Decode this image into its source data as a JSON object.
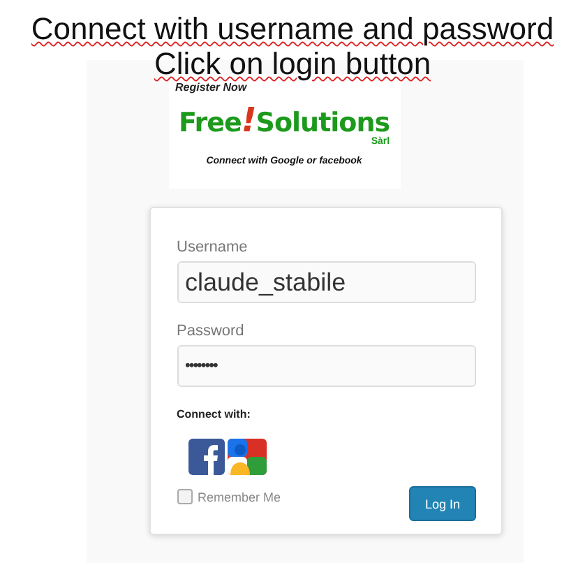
{
  "instructions": [
    "Connect with username and password",
    "Click on login button"
  ],
  "register_link": "Register Now",
  "logo": {
    "word_1": "Free",
    "mark": "!",
    "word_2": "Solutions",
    "suffix": "Sàrl",
    "tagline": "Connect with Google or facebook"
  },
  "form": {
    "username": {
      "label": "Username",
      "value": "claude_stabile"
    },
    "password": {
      "label": "Password",
      "value": "••••••••"
    },
    "connect_label": "Connect with:",
    "social": [
      {
        "kind": "facebook"
      },
      {
        "kind": "google"
      }
    ],
    "remember": {
      "label": "Remember Me",
      "checked": false
    },
    "submit": "Log In"
  }
}
